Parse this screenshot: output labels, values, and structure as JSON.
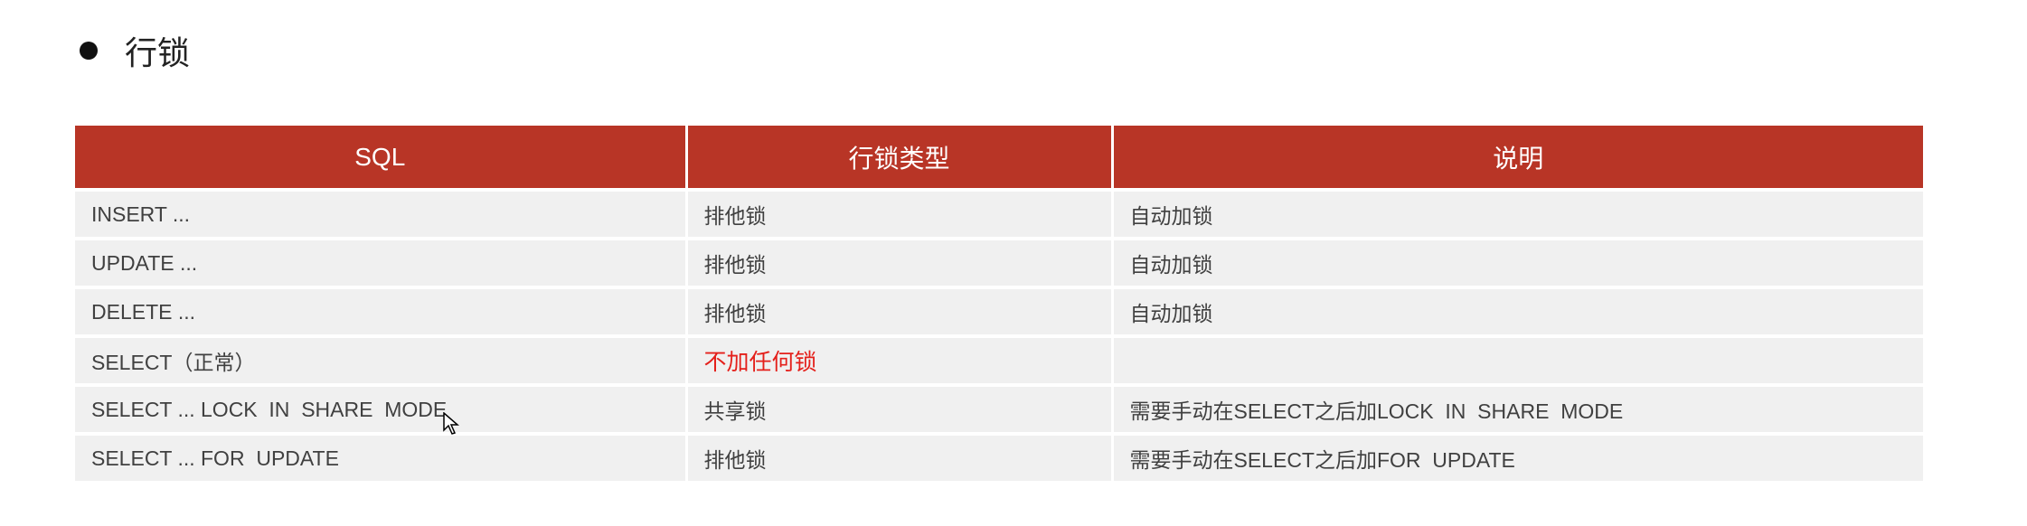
{
  "title": "行锁",
  "table": {
    "headers": [
      "SQL",
      "行锁类型",
      "说明"
    ],
    "rows": [
      {
        "sql": "INSERT ...",
        "type": "排他锁",
        "desc": "自动加锁"
      },
      {
        "sql": "UPDATE ...",
        "type": "排他锁",
        "desc": "自动加锁"
      },
      {
        "sql": "DELETE ...",
        "type": "排他锁",
        "desc": "自动加锁"
      },
      {
        "sql": "SELECT（正常）",
        "type": "不加任何锁",
        "desc": ""
      },
      {
        "sql": "SELECT ... LOCK  IN  SHARE  MODE",
        "type": "共享锁",
        "desc": "需要手动在SELECT之后加LOCK  IN  SHARE  MODE"
      },
      {
        "sql": "SELECT ... FOR  UPDATE",
        "type": "排他锁",
        "desc": "需要手动在SELECT之后加FOR  UPDATE"
      }
    ]
  },
  "colors": {
    "header_bg": "#b83526",
    "highlight": "#e4201b",
    "row_bg": "#f0f0f0"
  }
}
